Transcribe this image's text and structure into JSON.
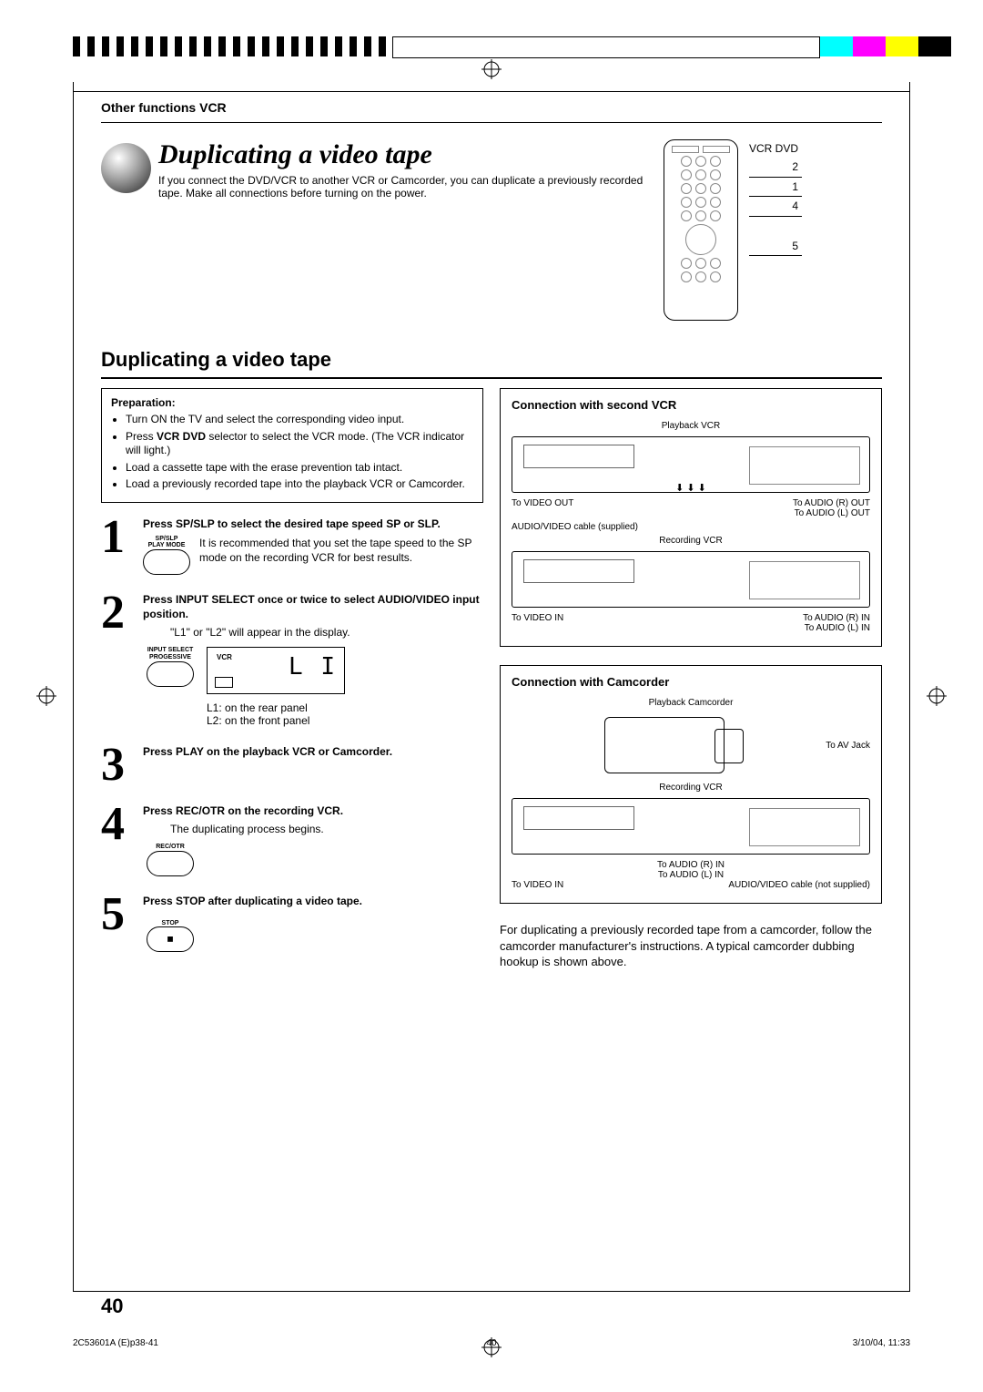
{
  "header": {
    "section": "Other functions VCR"
  },
  "title": {
    "main": "Duplicating a video tape",
    "intro": "If you connect the DVD/VCR to another VCR or Camcorder, you can duplicate a previously recorded tape. Make all connections before turning on the power."
  },
  "remote": {
    "label": "VCR DVD",
    "callouts": [
      "2",
      "1",
      "4",
      "5"
    ]
  },
  "subtitle": "Duplicating a video tape",
  "preparation": {
    "heading": "Preparation:",
    "items": [
      "Turn ON the TV and select the corresponding video input.",
      "Press VCR DVD selector to select the VCR mode. (The VCR indicator will light.)",
      "Load a cassette tape with the erase prevention tab intact.",
      "Load a previously recorded tape into the playback VCR or Camcorder."
    ],
    "bold_inline": "VCR DVD"
  },
  "steps": [
    {
      "num": "1",
      "head": "Press SP/SLP to select the desired tape speed SP or SLP.",
      "button_top": "SP/SLP",
      "button_bottom": "PLAY MODE",
      "desc": "It is recommended that you set the tape speed to the SP mode on the recording VCR for best results."
    },
    {
      "num": "2",
      "head": "Press INPUT SELECT once or twice to select AUDIO/VIDEO input position.",
      "desc": "\"L1\" or \"L2\" will appear in the display.",
      "button_top": "INPUT SELECT",
      "button_bottom": "PROGESSIVE",
      "display_vcr": "VCR",
      "display_seg": "L I",
      "note1": "L1: on the rear panel",
      "note2": "L2: on the front panel"
    },
    {
      "num": "3",
      "head": "Press PLAY on the playback VCR or Camcorder."
    },
    {
      "num": "4",
      "head": "Press REC/OTR on the recording VCR.",
      "desc": "The duplicating process begins.",
      "button_top": "REC/OTR"
    },
    {
      "num": "5",
      "head": "Press STOP after duplicating a video tape.",
      "button_top": "STOP",
      "stop_icon": "■"
    }
  ],
  "conn_vcr": {
    "heading": "Connection with second VCR",
    "playback": "Playback VCR",
    "to_video_out": "To VIDEO OUT",
    "to_audio_r_out": "To AUDIO (R) OUT",
    "to_audio_l_out": "To AUDIO (L) OUT",
    "cable": "AUDIO/VIDEO cable (supplied)",
    "recording": "Recording VCR",
    "to_video_in": "To VIDEO IN",
    "to_audio_r_in": "To AUDIO (R) IN",
    "to_audio_l_in": "To AUDIO (L) IN"
  },
  "conn_cam": {
    "heading": "Connection with Camcorder",
    "playback": "Playback Camcorder",
    "to_av": "To AV Jack",
    "recording": "Recording VCR",
    "to_audio_r_in": "To AUDIO (R) IN",
    "to_audio_l_in": "To AUDIO (L) IN",
    "to_video_in": "To VIDEO IN",
    "cable": "AUDIO/VIDEO cable (not supplied)",
    "footer_text": "For duplicating a previously recorded tape from a camcorder, follow the camcorder manufacturer's instructions. A typical camcorder dubbing hookup is shown above."
  },
  "page_number": "40",
  "footer": {
    "left": "2C53601A (E)p38-41",
    "mid": "40",
    "right": "3/10/04, 11:33"
  }
}
